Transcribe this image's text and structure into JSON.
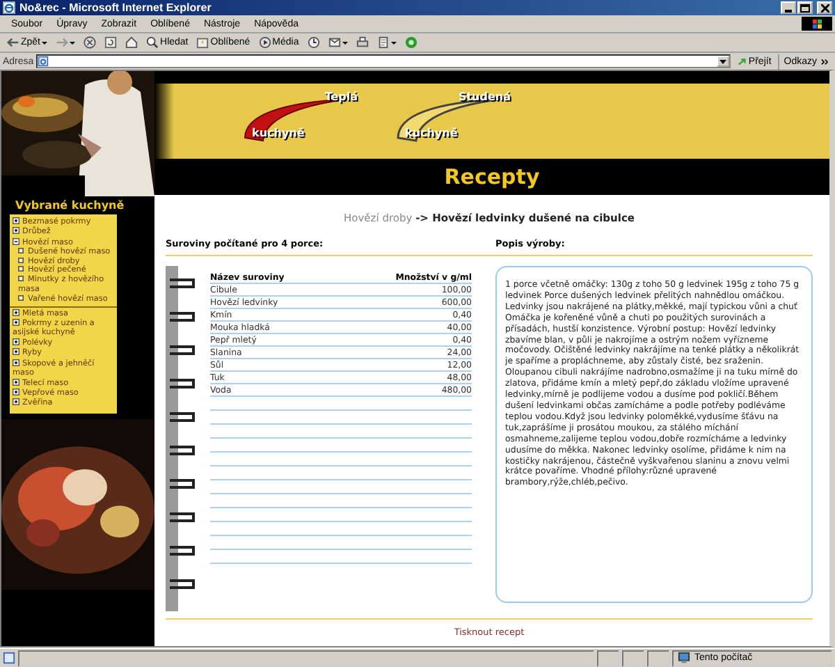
{
  "window": {
    "title": "No&rec - Microsoft Internet Explorer"
  },
  "menu": [
    "Soubor",
    "Úpravy",
    "Zobrazit",
    "Oblíbené",
    "Nástroje",
    "Nápověda"
  ],
  "toolbar": [
    {
      "label": "Zpět",
      "dropdown": true
    },
    {
      "dropdown": true
    },
    {
      "dropdown": false
    },
    {
      "dropdown": false
    },
    {
      "dropdown": false
    },
    {
      "label": "Hledat",
      "dropdown": false
    },
    {
      "label": "Oblíbené",
      "dropdown": false
    },
    {
      "label": "Média",
      "dropdown": false
    },
    {
      "dropdown": false
    },
    {
      "dropdown": true
    },
    {
      "dropdown": false
    },
    {
      "dropdown": true
    },
    {
      "dropdown": false
    }
  ],
  "address": {
    "label": "Adresa",
    "go": "Přejít",
    "links": "Odkazy"
  },
  "header": {
    "links": [
      {
        "kind": "hot",
        "top": "Teplá",
        "bottom": "kuchyně"
      },
      {
        "kind": "cold",
        "top": "Studená",
        "bottom": "kuchyně"
      }
    ],
    "title": "Recepty"
  },
  "sidebar": {
    "title": "Vybrané kuchyně",
    "items": [
      {
        "label": "Bezmasé pokrmy",
        "expanded": false
      },
      {
        "label": "Drůbež",
        "expanded": false
      },
      {
        "label": "Hovězí maso",
        "expanded": true,
        "children": [
          {
            "label": "Dušené hovězí maso"
          },
          {
            "label": "Hovězí droby"
          },
          {
            "label": "Hovězí pečené"
          },
          {
            "label": "Minutky z hovězího masa"
          },
          {
            "label": "Vařené hovězí maso"
          }
        ]
      },
      {
        "label": "Mletá masa",
        "expanded": false
      },
      {
        "label": "Pokrmy z uzenin a asijské kuchyně",
        "expanded": false
      },
      {
        "label": "Polévky",
        "expanded": false
      },
      {
        "label": "Ryby",
        "expanded": false
      },
      {
        "label": "Skopové a jehněčí maso",
        "expanded": false
      },
      {
        "label": "Telecí maso",
        "expanded": false
      },
      {
        "label": "Vepřové maso",
        "expanded": false
      },
      {
        "label": "Zvěřina",
        "expanded": false
      }
    ]
  },
  "breadcrumb": {
    "parent": "Hovězí droby",
    "current": "-> Hovězí ledvinky dušené na cibulce"
  },
  "ingredients": {
    "heading": "Suroviny počítané pro 4 porce:",
    "columns": [
      "Název suroviny",
      "Množství v g/ml"
    ],
    "rows": [
      [
        "Cibule",
        "100,00"
      ],
      [
        "Hovězí ledvinky",
        "600,00"
      ],
      [
        "Kmín",
        "0,40"
      ],
      [
        "Mouka hladká",
        "40,00"
      ],
      [
        "Pepř mletý",
        "0,40"
      ],
      [
        "Slanina",
        "24,00"
      ],
      [
        "Sůl",
        "12,00"
      ],
      [
        "Tuk",
        "48,00"
      ],
      [
        "Voda",
        "480,00"
      ]
    ]
  },
  "description": {
    "heading": "Popis výroby:",
    "text": "1 porce včetně omáčky: 130g z toho 50 g ledvinek 195g z toho 75 g ledvinek Porce dušených ledvinek přelitých nahnědlou omáčkou. Ledvinky jsou nakrájené na plátky,měkké, mají typickou vůni a chuť Omáčka je kořeněné vůně a chuti po použitých surovinách a přísadách, hustší konzistence. Výrobní postup: Hovězí ledvinky zbavíme blan, v půli je nakrojíme a ostrým nožem vyřízneme močovody. Očištěné ledvinky nakrájíme na tenké plátky a několikrát je spaříme a propláchneme, aby zůstaly čisté, bez sraženin. Oloupanou cibuli nakrájíme nadrobno,osmažíme ji na tuku mírně do zlatova, přidáme kmín a mletý pepř,do základu vložíme upravené ledvinky,mírně je podlijeme vodou a dusíme pod pokličí.Během dušení ledvinkami občas zamícháme a podle potřeby podléváme teplou vodou.Když jsou ledvinky poloměkké,vydusíme šťávu na tuk,zaprášíme ji prosátou moukou, za stálého míchání osmahneme,zalijeme teplou vodou,dobře rozmícháme a ledvinky udusíme do měkka. Nakonec ledvinky osolíme, přidáme k nim na kostičky nakrájenou, částečně vyškvařenou slaninu a znovu velmi krátce povaříme. Vhodné přílohy:různé upravené brambory,rýže,chléb,pečivo."
  },
  "print_link": "Tisknout recept",
  "status_bar": {
    "zone": "Tento počítač"
  }
}
